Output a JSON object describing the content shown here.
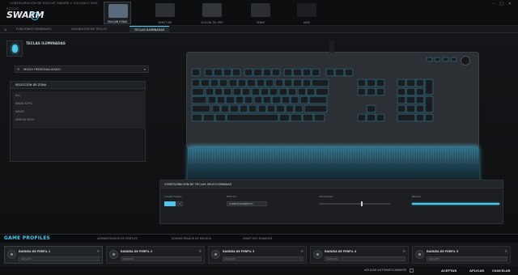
{
  "topbar": {
    "breadcrumb": "CONFIGURACIÓN DE ROCCAT SWARM  >  VULCAN II MAX",
    "logo_small": "ROCCAT",
    "logo_text": "SWARM",
    "devices": [
      {
        "label": "VULCAN II MAX",
        "color": "#5a6a7a",
        "active": true
      },
      {
        "label": "BURST AIR",
        "color": "#2c2f33",
        "active": false
      },
      {
        "label": "VULCAN TKL PRO",
        "color": "#33373b",
        "active": false
      },
      {
        "label": "SENSE",
        "color": "#2a2d31",
        "active": false
      },
      {
        "label": "AIMO",
        "color": "#1c1e21",
        "active": false
      }
    ],
    "window_buttons": [
      "–",
      "□",
      "✕"
    ]
  },
  "tabs": [
    {
      "label": "FUNCIONES GENERALES",
      "active": false
    },
    {
      "label": "ASIGNACIÓN DE TECLAS",
      "active": false
    },
    {
      "label": "TECLAS ILUMINADAS",
      "active": true
    }
  ],
  "ilum": {
    "title": "TECLAS ILUMINADAS",
    "mode": "MODO PERSONALIZADO",
    "zone_header": "SELECCIÓN DE ZONA",
    "zones": [
      "ALL",
      "WASD KEYS",
      "WASD",
      "ARROW KEYS"
    ]
  },
  "cfg": {
    "header": "CONFIGURACIÓN DE TECLAS SELECCIONADAS",
    "color_label": "COLOR FIJADO",
    "effect_label": "EFECTO",
    "effect_value": "COMPLETAMENTE R",
    "speed_label": "VELOCIDAD",
    "speed_value": 60,
    "bright_label": "BRILLO",
    "bright_value": 100,
    "accent": "#4cc7ee"
  },
  "bottom": {
    "title": "GAME PROFILES",
    "links": [
      "ADMINISTRADOR DE PERFILES",
      "ADMINISTRADOR DE MACROS",
      "SMART KEY MANAGER"
    ],
    "profiles": [
      {
        "name": "RANURA DE PERFIL 1",
        "value": "Default1",
        "active": true
      },
      {
        "name": "RANURA DE PERFIL 2",
        "value": "Default2",
        "active": false
      },
      {
        "name": "RANURA DE PERFIL 3",
        "value": "Default3",
        "active": false
      },
      {
        "name": "RANURA DE PERFIL 4",
        "value": "Default4",
        "active": false
      },
      {
        "name": "RANURA DE PERFIL 5",
        "value": "Default5",
        "active": false
      }
    ],
    "auto_apply": "APLICAR AUTOMÁTICAMENTE",
    "buttons": [
      "ACEPTAR",
      "APLICAR",
      "CANCELAR"
    ]
  }
}
